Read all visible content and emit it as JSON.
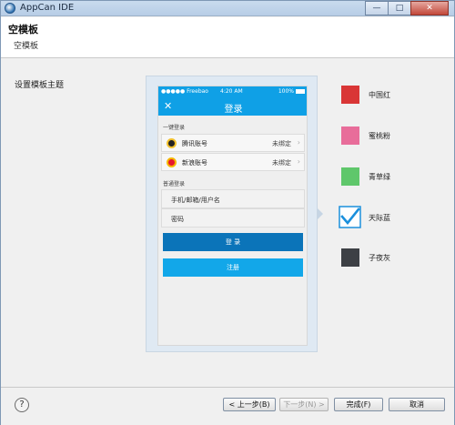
{
  "window": {
    "title": "AppCan IDE",
    "minimize": "—",
    "maximize": "□",
    "close": "✕"
  },
  "header": {
    "title": "空模板",
    "description": "空模板"
  },
  "main": {
    "theme_label": "设置模板主题"
  },
  "phone": {
    "status_carrier": "●●●●● Freebao",
    "status_time": "4:20 AM",
    "status_battery": "100%",
    "nav_close": "✕",
    "nav_title": "登录",
    "quick_login_label": "一键登录",
    "accounts": [
      {
        "label": "腾讯账号",
        "status": "未绑定",
        "icon": "qq-icon"
      },
      {
        "label": "新浪账号",
        "status": "未绑定",
        "icon": "weibo-icon"
      }
    ],
    "normal_login_label": "普通登录",
    "username_placeholder": "手机/邮箱/用户名",
    "password_placeholder": "密码",
    "login_button": "登 录",
    "register_button": "注册"
  },
  "themes": [
    {
      "label": "中国红",
      "color": "#d93636"
    },
    {
      "label": "蜜桃粉",
      "color": "#e86d9a"
    },
    {
      "label": "青草绿",
      "color": "#5fc76b"
    },
    {
      "label": "天际蓝",
      "color": "#1a8fdc",
      "selected": true
    },
    {
      "label": "子夜灰",
      "color": "#3d4045"
    }
  ],
  "footer": {
    "help": "?",
    "back": "< 上一步(B)",
    "next": "下一步(N) >",
    "finish": "完成(F)",
    "cancel": "取消"
  }
}
